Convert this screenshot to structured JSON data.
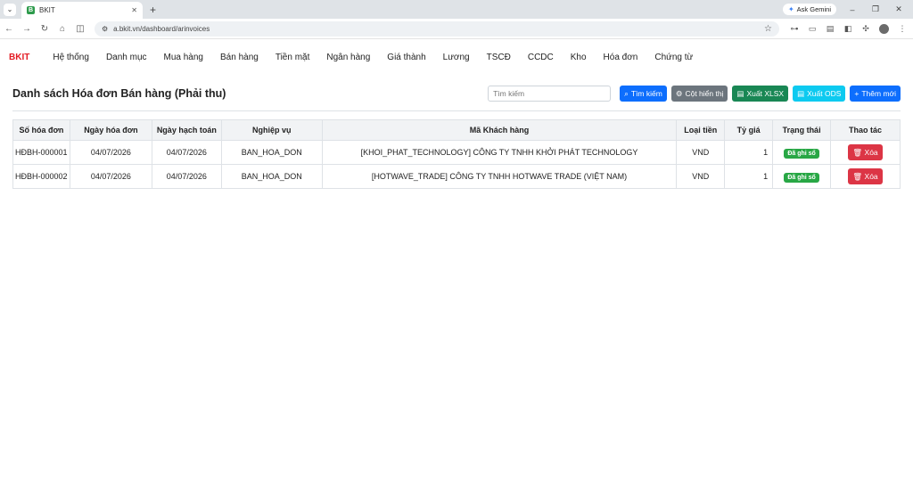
{
  "browser": {
    "tab_favicon": "B",
    "tab_title": "BKIT",
    "url": "a.bkit.vn/dashboard/arinvoices",
    "gemini_label": "Ask Gemini"
  },
  "nav": {
    "brand": "BKIT",
    "items": [
      "Hệ thống",
      "Danh mục",
      "Mua hàng",
      "Bán hàng",
      "Tiền mặt",
      "Ngân hàng",
      "Giá thành",
      "Lương",
      "TSCĐ",
      "CCDC",
      "Kho",
      "Hóa đơn",
      "Chứng từ"
    ]
  },
  "page": {
    "title": "Danh sách Hóa đơn Bán hàng (Phải thu)",
    "search_placeholder": "Tìm kiếm",
    "buttons": {
      "search": "Tìm kiếm",
      "columns": "Cột hiển thị",
      "export_xlsx": "Xuất XLSX",
      "export_ods": "Xuất ODS",
      "add_new": "Thêm mới"
    }
  },
  "table": {
    "headers": [
      "Số hóa đơn",
      "Ngày hóa đơn",
      "Ngày hạch toán",
      "Nghiệp vụ",
      "Mã Khách hàng",
      "Loại tiền",
      "Tỷ giá",
      "Trạng thái",
      "Thao tác"
    ],
    "rows": [
      {
        "invoice_no": "HĐBH-000001",
        "invoice_date": "04/07/2026",
        "posting_date": "04/07/2026",
        "operation": "BAN_HOA_DON",
        "customer": "[KHOI_PHAT_TECHNOLOGY] CÔNG TY TNHH KHỞI PHÁT TECHNOLOGY",
        "currency": "VND",
        "rate": "1",
        "status": "Đã ghi sổ",
        "action": "Xóa"
      },
      {
        "invoice_no": "HĐBH-000002",
        "invoice_date": "04/07/2026",
        "posting_date": "04/07/2026",
        "operation": "BAN_HOA_DON",
        "customer": "[HOTWAVE_TRADE] CÔNG TY TNHH HOTWAVE TRADE (VIỆT NAM)",
        "currency": "VND",
        "rate": "1",
        "status": "Đã ghi sổ",
        "action": "Xóa"
      }
    ]
  }
}
